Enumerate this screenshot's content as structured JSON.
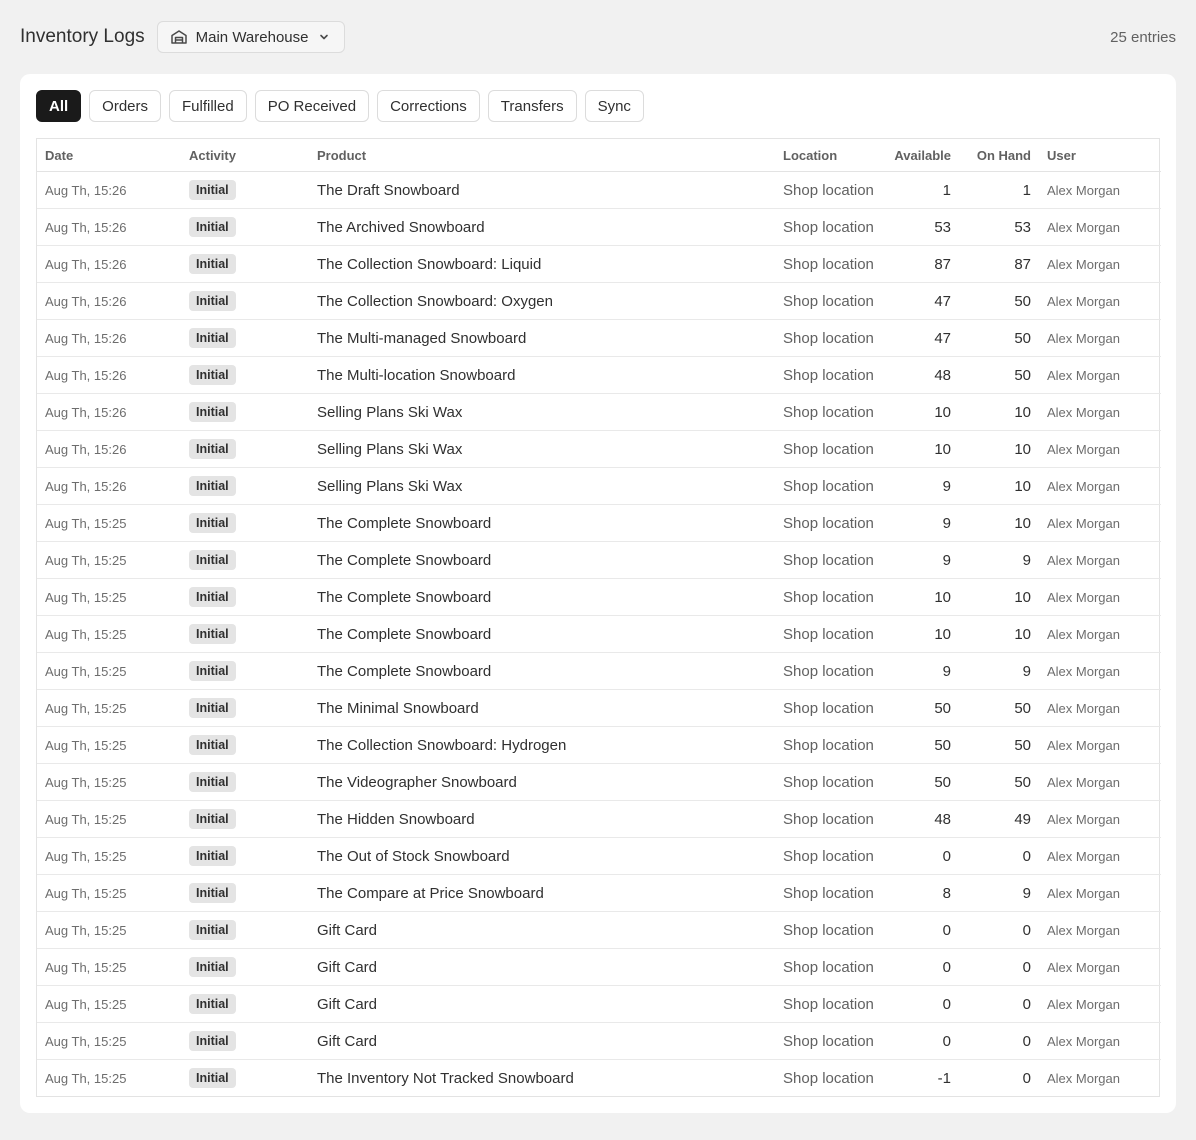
{
  "header": {
    "title": "Inventory Logs",
    "location_select": "Main Warehouse",
    "entries_count": "25 entries"
  },
  "tabs": [
    {
      "label": "All",
      "active": true
    },
    {
      "label": "Orders",
      "active": false
    },
    {
      "label": "Fulfilled",
      "active": false
    },
    {
      "label": "PO Received",
      "active": false
    },
    {
      "label": "Corrections",
      "active": false
    },
    {
      "label": "Transfers",
      "active": false
    },
    {
      "label": "Sync",
      "active": false
    }
  ],
  "table": {
    "columns": [
      "Date",
      "Activity",
      "Product",
      "Location",
      "Available",
      "On Hand",
      "User"
    ],
    "rows": [
      {
        "date": "Aug Th, 15:26",
        "activity": "Initial",
        "product": "The Draft Snowboard",
        "location": "Shop location",
        "available": "1",
        "on_hand": "1",
        "user": "Alex Morgan"
      },
      {
        "date": "Aug Th, 15:26",
        "activity": "Initial",
        "product": "The Archived Snowboard",
        "location": "Shop location",
        "available": "53",
        "on_hand": "53",
        "user": "Alex Morgan"
      },
      {
        "date": "Aug Th, 15:26",
        "activity": "Initial",
        "product": "The Collection Snowboard: Liquid",
        "location": "Shop location",
        "available": "87",
        "on_hand": "87",
        "user": "Alex Morgan"
      },
      {
        "date": "Aug Th, 15:26",
        "activity": "Initial",
        "product": "The Collection Snowboard: Oxygen",
        "location": "Shop location",
        "available": "47",
        "on_hand": "50",
        "user": "Alex Morgan"
      },
      {
        "date": "Aug Th, 15:26",
        "activity": "Initial",
        "product": "The Multi-managed Snowboard",
        "location": "Shop location",
        "available": "47",
        "on_hand": "50",
        "user": "Alex Morgan"
      },
      {
        "date": "Aug Th, 15:26",
        "activity": "Initial",
        "product": "The Multi-location Snowboard",
        "location": "Shop location",
        "available": "48",
        "on_hand": "50",
        "user": "Alex Morgan"
      },
      {
        "date": "Aug Th, 15:26",
        "activity": "Initial",
        "product": "Selling Plans Ski Wax",
        "location": "Shop location",
        "available": "10",
        "on_hand": "10",
        "user": "Alex Morgan"
      },
      {
        "date": "Aug Th, 15:26",
        "activity": "Initial",
        "product": "Selling Plans Ski Wax",
        "location": "Shop location",
        "available": "10",
        "on_hand": "10",
        "user": "Alex Morgan"
      },
      {
        "date": "Aug Th, 15:26",
        "activity": "Initial",
        "product": "Selling Plans Ski Wax",
        "location": "Shop location",
        "available": "9",
        "on_hand": "10",
        "user": "Alex Morgan"
      },
      {
        "date": "Aug Th, 15:25",
        "activity": "Initial",
        "product": "The Complete Snowboard",
        "location": "Shop location",
        "available": "9",
        "on_hand": "10",
        "user": "Alex Morgan"
      },
      {
        "date": "Aug Th, 15:25",
        "activity": "Initial",
        "product": "The Complete Snowboard",
        "location": "Shop location",
        "available": "9",
        "on_hand": "9",
        "user": "Alex Morgan"
      },
      {
        "date": "Aug Th, 15:25",
        "activity": "Initial",
        "product": "The Complete Snowboard",
        "location": "Shop location",
        "available": "10",
        "on_hand": "10",
        "user": "Alex Morgan"
      },
      {
        "date": "Aug Th, 15:25",
        "activity": "Initial",
        "product": "The Complete Snowboard",
        "location": "Shop location",
        "available": "10",
        "on_hand": "10",
        "user": "Alex Morgan"
      },
      {
        "date": "Aug Th, 15:25",
        "activity": "Initial",
        "product": "The Complete Snowboard",
        "location": "Shop location",
        "available": "9",
        "on_hand": "9",
        "user": "Alex Morgan"
      },
      {
        "date": "Aug Th, 15:25",
        "activity": "Initial",
        "product": "The Minimal Snowboard",
        "location": "Shop location",
        "available": "50",
        "on_hand": "50",
        "user": "Alex Morgan"
      },
      {
        "date": "Aug Th, 15:25",
        "activity": "Initial",
        "product": "The Collection Snowboard: Hydrogen",
        "location": "Shop location",
        "available": "50",
        "on_hand": "50",
        "user": "Alex Morgan"
      },
      {
        "date": "Aug Th, 15:25",
        "activity": "Initial",
        "product": "The Videographer Snowboard",
        "location": "Shop location",
        "available": "50",
        "on_hand": "50",
        "user": "Alex Morgan"
      },
      {
        "date": "Aug Th, 15:25",
        "activity": "Initial",
        "product": "The Hidden Snowboard",
        "location": "Shop location",
        "available": "48",
        "on_hand": "49",
        "user": "Alex Morgan"
      },
      {
        "date": "Aug Th, 15:25",
        "activity": "Initial",
        "product": "The Out of Stock Snowboard",
        "location": "Shop location",
        "available": "0",
        "on_hand": "0",
        "user": "Alex Morgan"
      },
      {
        "date": "Aug Th, 15:25",
        "activity": "Initial",
        "product": "The Compare at Price Snowboard",
        "location": "Shop location",
        "available": "8",
        "on_hand": "9",
        "user": "Alex Morgan"
      },
      {
        "date": "Aug Th, 15:25",
        "activity": "Initial",
        "product": "Gift Card",
        "location": "Shop location",
        "available": "0",
        "on_hand": "0",
        "user": "Alex Morgan"
      },
      {
        "date": "Aug Th, 15:25",
        "activity": "Initial",
        "product": "Gift Card",
        "location": "Shop location",
        "available": "0",
        "on_hand": "0",
        "user": "Alex Morgan"
      },
      {
        "date": "Aug Th, 15:25",
        "activity": "Initial",
        "product": "Gift Card",
        "location": "Shop location",
        "available": "0",
        "on_hand": "0",
        "user": "Alex Morgan"
      },
      {
        "date": "Aug Th, 15:25",
        "activity": "Initial",
        "product": "Gift Card",
        "location": "Shop location",
        "available": "0",
        "on_hand": "0",
        "user": "Alex Morgan"
      },
      {
        "date": "Aug Th, 15:25",
        "activity": "Initial",
        "product": "The Inventory Not Tracked Snowboard",
        "location": "Shop location",
        "available": "-1",
        "on_hand": "0",
        "user": "Alex Morgan"
      }
    ]
  },
  "icons": {
    "warehouse": "warehouse-icon",
    "dropdown": "chevron-down-icon"
  },
  "colors": {
    "active_tab_bg": "#1a1a1a",
    "badge_bg": "#e4e4e4",
    "page_bg": "#f1f1f1"
  }
}
